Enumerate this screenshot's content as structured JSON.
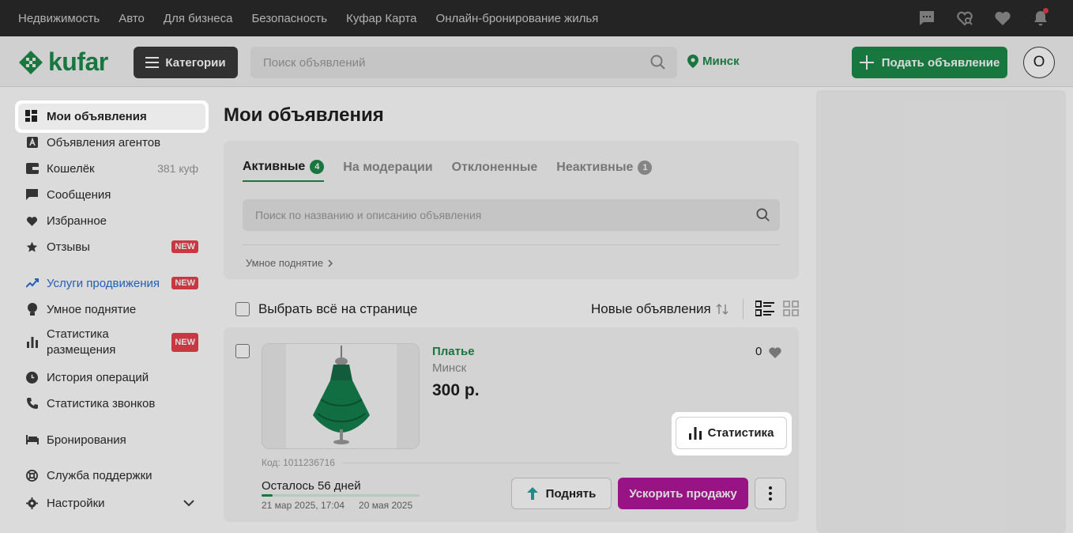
{
  "topnav": {
    "links": [
      "Недвижимость",
      "Авто",
      "Для бизнеса",
      "Безопасность",
      "Куфар Карта",
      "Онлайн-бронирование жилья"
    ],
    "icons": [
      "chat-icon",
      "heart-search-icon",
      "heart-icon",
      "bell-icon"
    ]
  },
  "header": {
    "logo_text": "kufar",
    "categories_label": "Категории",
    "search_placeholder": "Поиск объявлений",
    "city": "Минск",
    "post_ad_label": "Подать объявление",
    "avatar_letter": "О"
  },
  "sidebar": {
    "items": [
      {
        "label": "Мои объявления",
        "icon": "dashboard-icon",
        "active": true
      },
      {
        "label": "Объявления агентов",
        "icon": "agent-icon"
      },
      {
        "label": "Кошелёк",
        "icon": "wallet-icon",
        "extra": "381 куф"
      },
      {
        "label": "Сообщения",
        "icon": "message-icon"
      },
      {
        "label": "Избранное",
        "icon": "heart-icon"
      },
      {
        "label": "Отзывы",
        "icon": "star-icon",
        "badge": "NEW"
      },
      {
        "label": "Услуги продвижения",
        "icon": "trend-up-icon",
        "badge": "NEW"
      },
      {
        "label": "Умное поднятие",
        "icon": "bulb-icon"
      },
      {
        "label": "Статистика размещения",
        "icon": "bar-chart-icon",
        "badge": "NEW"
      },
      {
        "label": "История операций",
        "icon": "clock-icon"
      },
      {
        "label": "Статистика звонков",
        "icon": "phone-icon"
      },
      {
        "label": "Бронирования",
        "icon": "bed-icon"
      },
      {
        "label": "Служба поддержки",
        "icon": "lifebuoy-icon"
      },
      {
        "label": "Настройки",
        "icon": "gear-icon"
      }
    ]
  },
  "main": {
    "title": "Мои объявления",
    "tabs": [
      {
        "label": "Активные",
        "count": "4"
      },
      {
        "label": "На модерации"
      },
      {
        "label": "Отклоненные"
      },
      {
        "label": "Неактивные",
        "count": "1"
      }
    ],
    "search_placeholder": "Поиск по названию и описанию объявления",
    "smart_raise_link": "Умное поднятие",
    "select_all": "Выбрать всё на странице",
    "sort_label": "Новые объявления"
  },
  "ad": {
    "title": "Платье",
    "city": "Минск",
    "price": "300 р.",
    "favorites_count": "0",
    "code": "Код: 1011236716",
    "remaining": "Осталось 56 дней",
    "remaining_progress": 0.07,
    "date_start": "21 мар 2025, 17:04",
    "date_end": "20 мая 2025",
    "raise_label": "Поднять",
    "boost_label": "Ускорить продажу",
    "stats_label": "Статистика"
  },
  "colors": {
    "brand_green": "#1c8b4a",
    "boost_purple": "#b2189a",
    "badge_red": "#e8424e",
    "topbar": "#2b2b2b"
  }
}
